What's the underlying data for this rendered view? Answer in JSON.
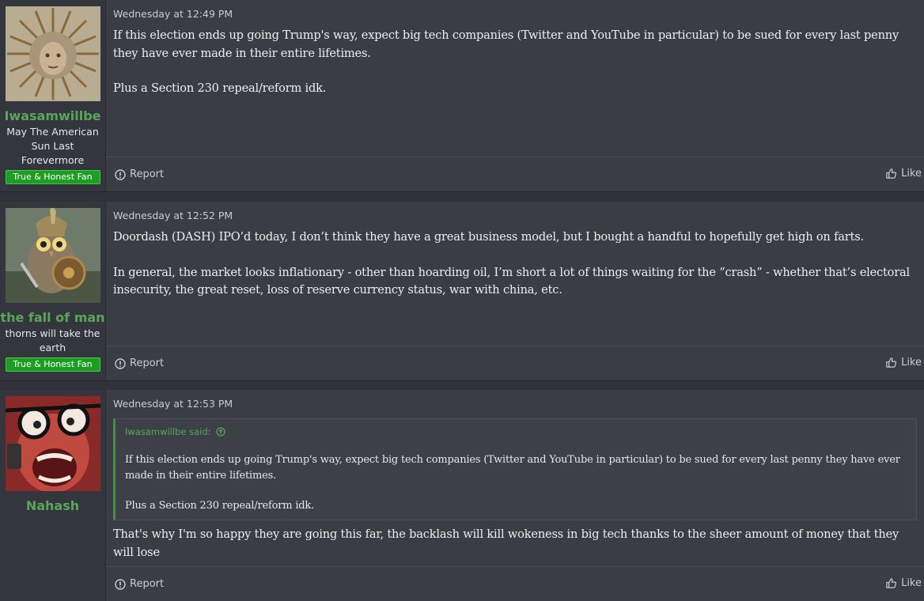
{
  "posts": [
    {
      "username": "Iwasamwillbe",
      "user_title": "May The American Sun Last Forevermore",
      "badge": "True & Honest Fan",
      "timestamp": "Wednesday at 12:49 PM",
      "paragraphs": [
        "If this election ends up going Trump's way, expect big tech companies (Twitter and YouTube in particular) to be sued for every last penny they have ever made in their entire lifetimes.",
        "Plus a Section 230 repeal/reform idk."
      ],
      "report_label": "Report",
      "like_label": "Like"
    },
    {
      "username": "the fall of man",
      "user_title": "thorns will take the earth",
      "badge": "True & Honest Fan",
      "timestamp": "Wednesday at 12:52 PM",
      "paragraphs": [
        "Doordash (DASH) IPO’d today, I don’t think they have a great business model, but I bought a handful to hopefully get high on farts.",
        "In general, the market looks inflationary - other than hoarding oil, I’m short a lot of things waiting for the “crash” - whether that’s electoral insecurity, the great reset, loss of reserve currency status, war with china, etc."
      ],
      "report_label": "Report",
      "like_label": "Like"
    },
    {
      "username": "Nahash",
      "timestamp": "Wednesday at 12:53 PM",
      "quote": {
        "author_said": "Iwasamwillbe said:",
        "paragraphs": [
          "If this election ends up going Trump's way, expect big tech companies (Twitter and YouTube in particular) to be sued for every last penny they have ever made in their entire lifetimes.",
          "Plus a Section 230 repeal/reform idk."
        ]
      },
      "paragraphs": [
        "That's why I'm so happy they are going this far, the backlash will kill wokeness in big tech thanks to the sheer amount of money that they will lose"
      ],
      "report_label": "Report",
      "like_label": "Like"
    }
  ],
  "colors": {
    "username": "#5aa55a",
    "badge_bg": "#1d9e23",
    "post_bg": "#3a3d44",
    "user_panel_bg": "#33363c"
  },
  "icons": {
    "report": "report-icon",
    "like": "thumbs-up-icon",
    "quote_jump": "arrow-up-circle-icon"
  }
}
